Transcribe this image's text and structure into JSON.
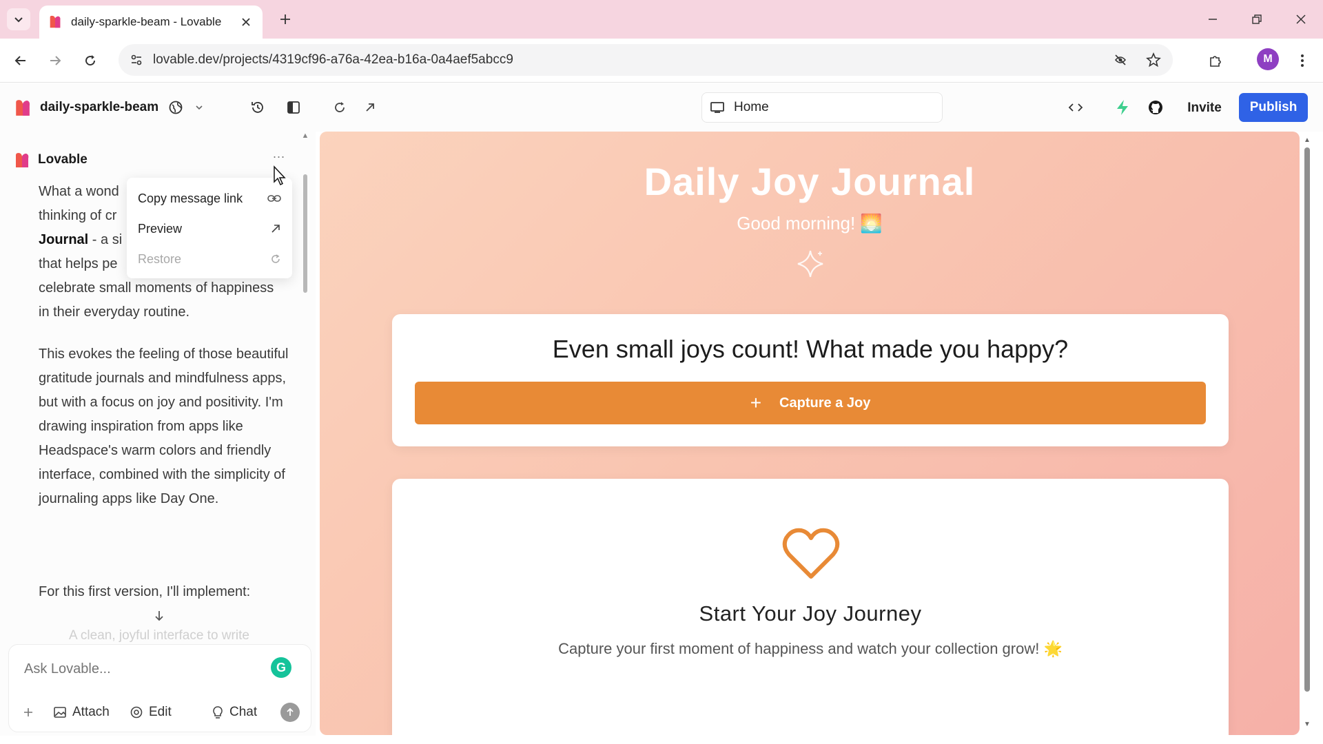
{
  "browser": {
    "tab_title": "daily-sparkle-beam - Lovable",
    "url": "lovable.dev/projects/4319cf96-a76a-42ea-b16a-0a4aef5abcc9",
    "profile_initial": "M"
  },
  "toolbar": {
    "project_name": "daily-sparkle-beam",
    "route": "Home",
    "invite_label": "Invite",
    "publish_label": "Publish"
  },
  "chat": {
    "sender": "Lovable",
    "more_label": "...",
    "paragraph1_a": "What a wond",
    "paragraph1_b": "thinking of cr",
    "paragraph1_bold": "Journal",
    "paragraph1_c": " - a si",
    "paragraph1_d": "that helps pe",
    "paragraph1_e": "celebrate small moments of happiness in their everyday routine.",
    "paragraph2": "This evokes the feeling of those beautiful gratitude journals and mindfulness apps, but with a focus on joy and positivity. I'm drawing inspiration from apps like Headspace's warm colors and friendly interface, combined with the simplicity of journaling apps like Day One.",
    "paragraph3": "For this first version, I'll implement:",
    "faded_line": "A clean, joyful interface to write",
    "context_menu": [
      {
        "label": "Copy message link",
        "icon": "link-icon",
        "enabled": true
      },
      {
        "label": "Preview",
        "icon": "arrow-up-right-icon",
        "enabled": true
      },
      {
        "label": "Restore",
        "icon": "restore-icon",
        "enabled": false
      }
    ],
    "composer": {
      "placeholder": "Ask Lovable...",
      "attach_label": "Attach",
      "edit_label": "Edit",
      "chat_label": "Chat"
    }
  },
  "preview": {
    "title": "Daily Joy Journal",
    "greeting": "Good morning! 🌅",
    "prompt": "Even small joys count! What made you happy?",
    "capture_button": "Capture a Joy",
    "empty_title": "Start Your Joy Journey",
    "empty_text": "Capture your first moment of happiness and watch your collection grow! 🌟"
  },
  "colors": {
    "publish": "#2f62e6",
    "capture_button": "#e88a36",
    "tabbar": "#f6d5e0",
    "heart": "#e88a36"
  }
}
